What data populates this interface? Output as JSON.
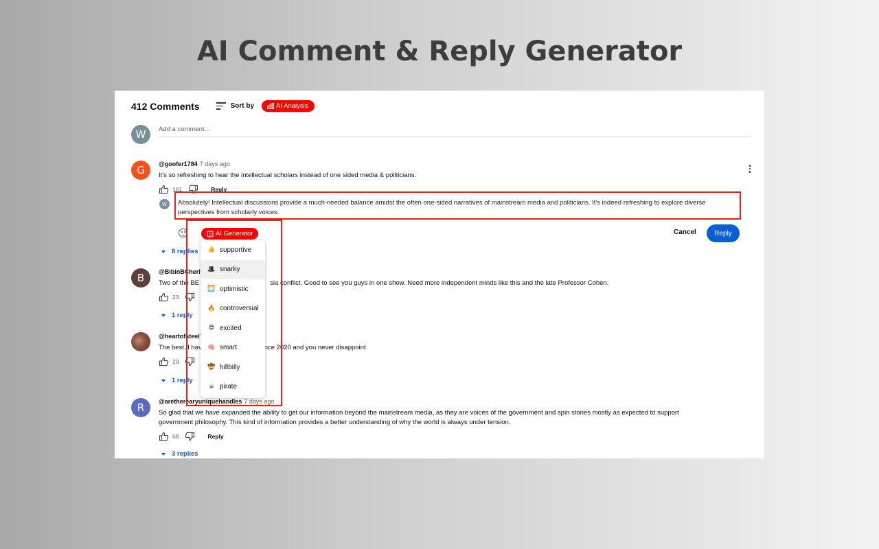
{
  "page_title": "AI Comment & Reply Generator",
  "header": {
    "count": "412 Comments",
    "sort_label": "Sort by",
    "ai_analysis_label": "AI Analysis"
  },
  "add_comment": {
    "avatar_letter": "W",
    "placeholder": "Add a comment..."
  },
  "comments": [
    {
      "avatar_letter": "G",
      "avatar_color": "#f4511e",
      "user": "@goofer1784",
      "time": "7 days ago",
      "text": "It's so refreshing to hear the intellectual scholars instead of one sided media & politicians.",
      "likes": "161",
      "reply_label": "Reply",
      "replies": "8 replies"
    },
    {
      "avatar_letter": "B",
      "avatar_color": "#5d4037",
      "user": "@BibinBCheria",
      "text_left": "Two of the BE",
      "text_right": "sia conflict. Good to see you guys in one show. Need more independent minds like this and the late Professor Cohen.",
      "likes": "23",
      "replies": "1 reply"
    },
    {
      "user": "@heartofsteel7",
      "text_left": "The best. I hav",
      "text_right": "since 2020 and you never disappoint",
      "likes": "29",
      "replies": "1 reply"
    },
    {
      "avatar_letter": "R",
      "avatar_color": "#5c6bc0",
      "user": "@aretherearyuniquehandles",
      "time": "7 days ago",
      "text_line1": "So glad that we have expanded the ability to get our information beyond the mainstream media, as they are voices of the government and spin stories mostly as expected to support",
      "text_line2": "government philosophy.   This kind of information provides a better understanding of why the world is always under tension.",
      "likes": "68",
      "reply_label": "Reply",
      "replies": "3 replies"
    }
  ],
  "reply_box": {
    "avatar_letter": "W",
    "text": "Absolutely! Intellectual discussions provide a much-needed balance amidst the often one-sided narratives of mainstream media and politicians. It's indeed refreshing to explore diverse perspectives from scholarly voices.",
    "cancel_label": "Cancel",
    "reply_label": "Reply",
    "generator_label": "AI Generator"
  },
  "tone_menu": [
    {
      "emoji": "👍",
      "label": "supportive"
    },
    {
      "emoji": "🎩",
      "label": "snarky",
      "highlighted": true
    },
    {
      "emoji": "🌅",
      "label": "optimistic"
    },
    {
      "emoji": "🔥",
      "label": "controversial"
    },
    {
      "emoji": "😍",
      "label": "excited"
    },
    {
      "emoji": "🧠",
      "label": "smart"
    },
    {
      "emoji": "🤠",
      "label": "hillbilly"
    },
    {
      "emoji": "☠",
      "label": "pirate"
    }
  ],
  "colors": {
    "accent_red": "#ff0000",
    "highlight_box": "#ee1c1c",
    "reply_blue": "#065fd4"
  }
}
